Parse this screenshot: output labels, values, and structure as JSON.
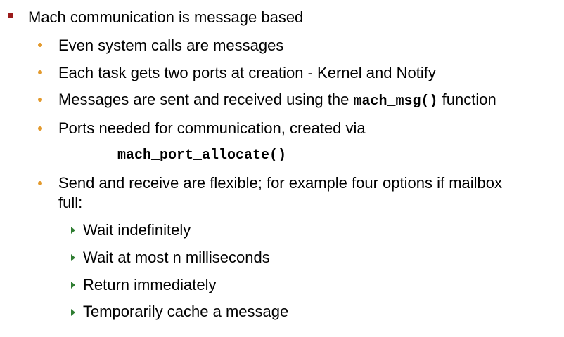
{
  "colors": {
    "level1_bullet": "#9b1b1b",
    "level2_bullet": "#e39a2d",
    "level3_bullet": "#2f7d32"
  },
  "slide": {
    "item1": "Mach communication is message based",
    "item1_1": "Even system calls are messages",
    "item1_2": "Each task gets two ports at creation  - Kernel and Notify",
    "item1_3_pre": "Messages are sent and received using the ",
    "item1_3_code": "mach_msg()",
    "item1_3_post": " function",
    "item1_4": "Ports needed for communication, created via",
    "item1_4_code": "mach_port_allocate()",
    "item1_5_line1": "Send and receive are flexible; for example four options if mailbox",
    "item1_5_line2": "full:",
    "sub_items": [
      "Wait indefinitely",
      "Wait at most n milliseconds",
      "Return immediately",
      "Temporarily cache a message"
    ]
  }
}
